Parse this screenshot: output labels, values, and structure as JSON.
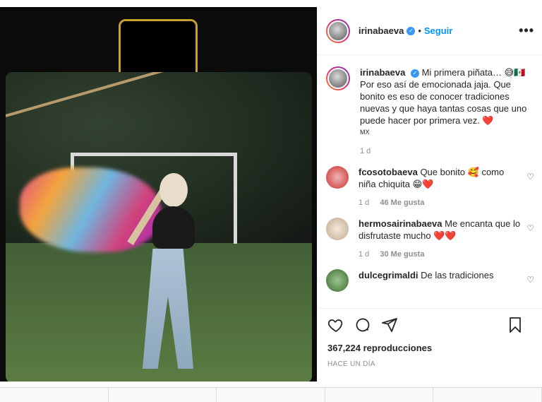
{
  "post": {
    "username": "irinabaeva",
    "follow_label": "Seguir",
    "more_label": "•••",
    "caption": {
      "text": "Mi primera piñata… 😅🇲🇽 Por eso así de emocionada jaja. Que bonito es eso de conocer tradiciones nuevas y que haya tantas cosas que uno puede hacer por primera vez. ❤️",
      "flag_text": "MX",
      "time": "1 d"
    },
    "comments": [
      {
        "user": "fcosotobaeva",
        "text": "Que bonito 🥰 como niña chiquita 😁❤️",
        "time": "1 d",
        "likes": "46 Me gusta"
      },
      {
        "user": "hermosairinabaeva",
        "text": "Me encanta que lo disfrutaste mucho ❤️❤️",
        "time": "1 d",
        "likes": "30 Me gusta"
      },
      {
        "user": "dulcegrimaldi",
        "text": "De las tradiciones",
        "time": "",
        "likes": ""
      }
    ],
    "views": "367,224 reproducciones",
    "posted": "HACE UN DÍA"
  },
  "icons": {
    "like": "heart-icon",
    "comment": "comment-icon",
    "share": "share-icon",
    "save": "bookmark-icon",
    "verified": "verified-icon"
  },
  "colors": {
    "accent": "#0095f6",
    "verified": "#3897f0",
    "heart": "#ed4956"
  }
}
